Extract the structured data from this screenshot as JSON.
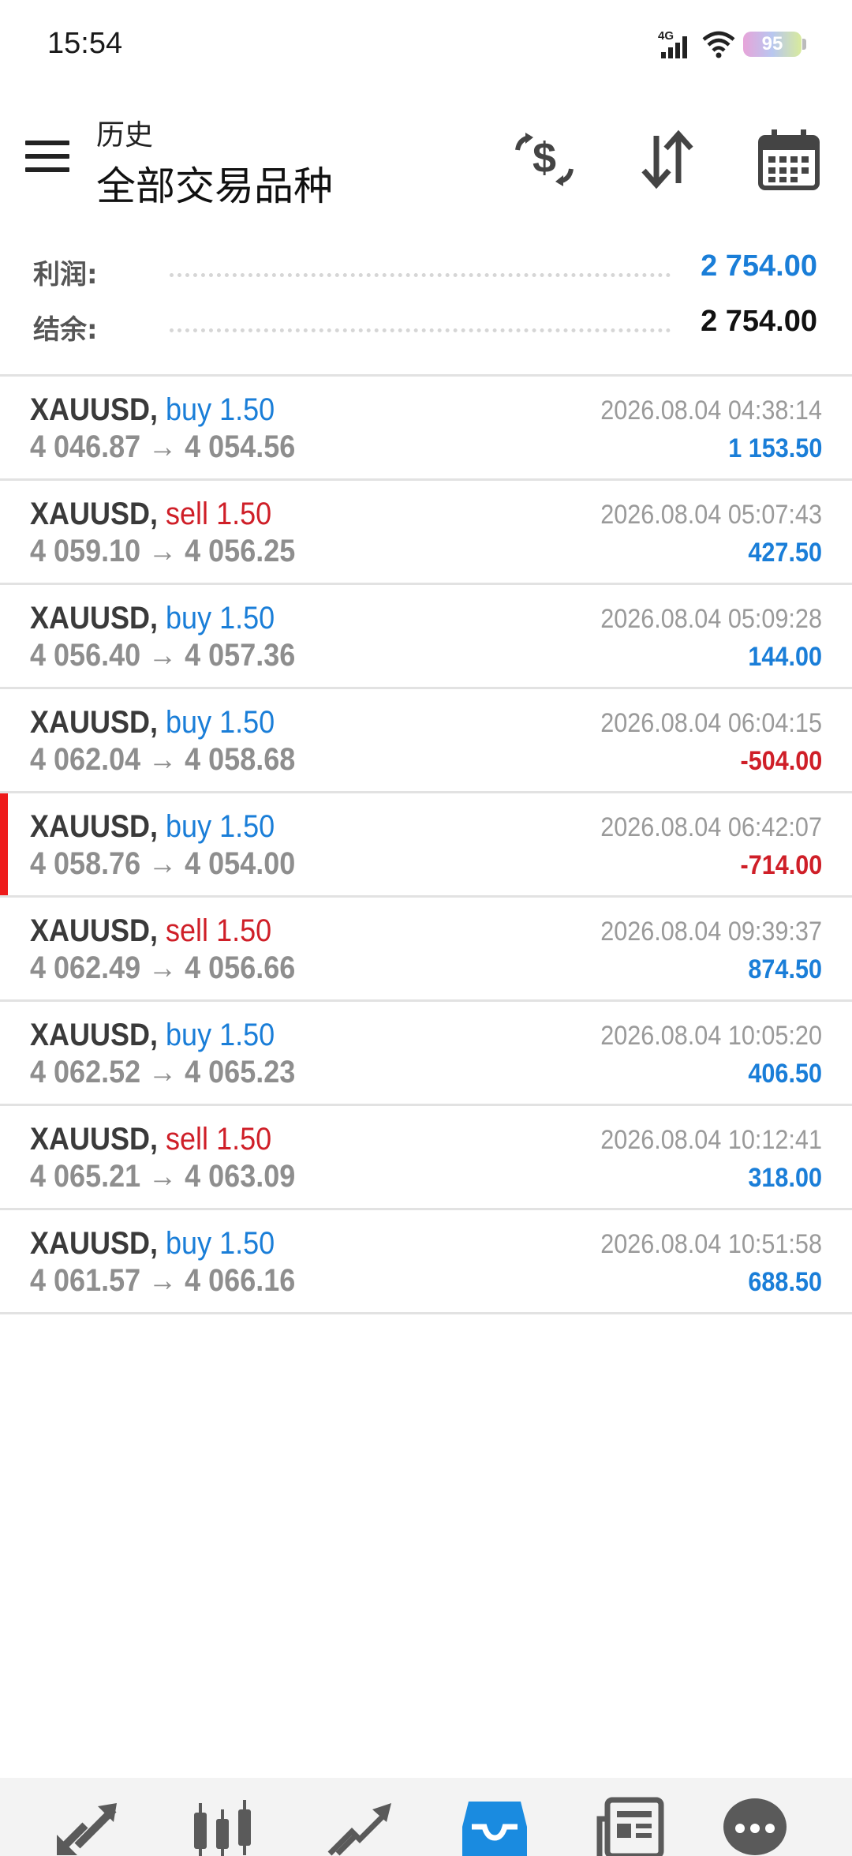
{
  "status_bar": {
    "time": "15:54",
    "network": "4G",
    "battery": "95"
  },
  "header": {
    "subtitle": "历史",
    "title": "全部交易品种"
  },
  "toolbar": {
    "icons": [
      "currency-exchange-icon",
      "sort-icon",
      "calendar-icon"
    ]
  },
  "summary": {
    "profit_label": "利润:",
    "profit_value": "2 754.00",
    "balance_label": "结余:",
    "balance_value": "2 754.00"
  },
  "colors": {
    "buy": "#1a7ed8",
    "sell": "#cf1f28",
    "profit_positive": "#1a7ed8",
    "profit_negative": "#cf1f28",
    "active_marker": "#ee1b1b"
  },
  "trades": [
    {
      "symbol": "XAUUSD,",
      "side": "buy",
      "volume": "1.50",
      "prices": "4 046.87 → 4 054.56",
      "time": "2026.08.04 04:38:14",
      "profit": "1 153.50"
    },
    {
      "symbol": "XAUUSD,",
      "side": "sell",
      "volume": "1.50",
      "prices": "4 059.10 → 4 056.25",
      "time": "2026.08.04 05:07:43",
      "profit": "427.50"
    },
    {
      "symbol": "XAUUSD,",
      "side": "buy",
      "volume": "1.50",
      "prices": "4 056.40 → 4 057.36",
      "time": "2026.08.04 05:09:28",
      "profit": "144.00"
    },
    {
      "symbol": "XAUUSD,",
      "side": "buy",
      "volume": "1.50",
      "prices": "4 062.04 → 4 058.68",
      "time": "2026.08.04 06:04:15",
      "profit": "-504.00"
    },
    {
      "symbol": "XAUUSD,",
      "side": "buy",
      "volume": "1.50",
      "prices": "4 058.76 → 4 054.00",
      "time": "2026.08.04 06:42:07",
      "profit": "-714.00"
    },
    {
      "symbol": "XAUUSD,",
      "side": "sell",
      "volume": "1.50",
      "prices": "4 062.49 → 4 056.66",
      "time": "2026.08.04 09:39:37",
      "profit": "874.50"
    },
    {
      "symbol": "XAUUSD,",
      "side": "buy",
      "volume": "1.50",
      "prices": "4 062.52 → 4 065.23",
      "time": "2026.08.04 10:05:20",
      "profit": "406.50"
    },
    {
      "symbol": "XAUUSD,",
      "side": "sell",
      "volume": "1.50",
      "prices": "4 065.21 → 4 063.09",
      "time": "2026.08.04 10:12:41",
      "profit": "318.00"
    },
    {
      "symbol": "XAUUSD,",
      "side": "buy",
      "volume": "1.50",
      "prices": "4 061.57 → 4 066.16",
      "time": "2026.08.04 10:51:58",
      "profit": "688.50"
    }
  ],
  "bottom_nav": {
    "items": [
      "quotes-icon",
      "chart-icon",
      "trade-icon",
      "history-icon",
      "news-icon",
      "chat-icon"
    ],
    "active": "history-icon"
  }
}
